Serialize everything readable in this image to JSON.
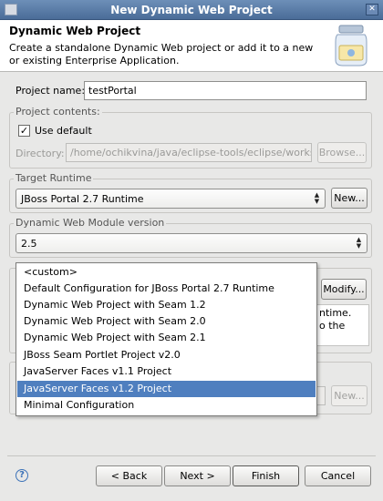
{
  "window": {
    "title": "New Dynamic Web Project"
  },
  "header": {
    "title": "Dynamic Web Project",
    "description": "Create a standalone Dynamic Web project or add it to a new or existing Enterprise Application."
  },
  "project_name": {
    "label": "Project name:",
    "value": "testPortal"
  },
  "project_contents": {
    "group_title": "Project contents:",
    "use_default_label": "Use default",
    "use_default_checked": true,
    "directory_label": "Directory:",
    "directory_value": "/home/ochikvina/java/eclipse-tools/eclipse/workspac",
    "browse_label": "Browse..."
  },
  "target_runtime": {
    "group_title": "Target Runtime",
    "selected": "JBoss Portal 2.7 Runtime",
    "new_label": "New..."
  },
  "web_module": {
    "group_title": "Dynamic Web Module version",
    "selected": "2.5"
  },
  "configuration": {
    "modify_label": "Modify...",
    "hidden_text_line1": "ntime.",
    "hidden_text_line2": "o the",
    "new_label_2": "New...",
    "dropdown_options": [
      "<custom>",
      "Default Configuration for JBoss Portal 2.7 Runtime",
      "Dynamic Web Project with Seam 1.2",
      "Dynamic Web Project with Seam 2.0",
      "Dynamic Web Project with Seam 2.1",
      "JBoss Seam Portlet Project v2.0",
      "JavaServer Faces v1.1 Project",
      "JavaServer Faces v1.2 Project",
      "Minimal Configuration"
    ],
    "selected_option": "JavaServer Faces v1.2 Project"
  },
  "footer": {
    "help_glyph": "?",
    "back_label": "< Back",
    "next_label": "Next >",
    "finish_label": "Finish",
    "cancel_label": "Cancel"
  },
  "colors": {
    "selection": "#4f7fbf",
    "titlebar": "#4a6c98"
  }
}
